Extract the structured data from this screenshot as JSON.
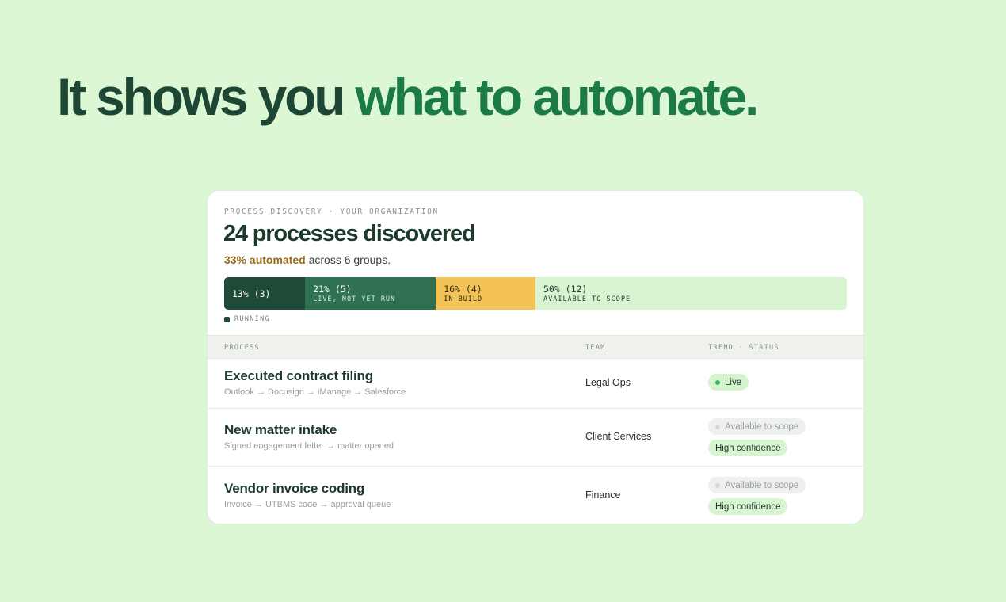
{
  "headline": {
    "prefix": "It shows you",
    "accent": "what to automate."
  },
  "card": {
    "eyebrow": "PROCESS DISCOVERY · YOUR ORGANIZATION",
    "title": "24 processes discovered",
    "automated": "33% automated",
    "subline_rest": " across 6 groups.",
    "segments": [
      {
        "value": "13% (3)",
        "label": "",
        "percent": 13,
        "color": "#1f4a37"
      },
      {
        "value": "21% (5)",
        "label": "LIVE, NOT YET RUN",
        "percent": 21,
        "color": "#2f7050"
      },
      {
        "value": "16% (4)",
        "label": "IN BUILD",
        "percent": 16,
        "color": "#f4c357"
      },
      {
        "value": "50% (12)",
        "label": "AVAILABLE TO SCOPE",
        "percent": 50,
        "color": "#d7f5d0"
      }
    ],
    "legend": "RUNNING",
    "table": {
      "headers": {
        "process": "PROCESS",
        "team": "TEAM",
        "status": "TREND · STATUS"
      },
      "rows": [
        {
          "name": "Executed contract filing",
          "path": "Outlook → Docusign → iManage → Salesforce",
          "team": "Legal Ops",
          "status": "Live",
          "confidence": ""
        },
        {
          "name": "New matter intake",
          "path": "Signed engagement letter → matter opened",
          "team": "Client Services",
          "status": "Available to scope",
          "confidence": "High confidence"
        },
        {
          "name": "Vendor invoice coding",
          "path": "Invoice → UTBMS code → approval queue",
          "team": "Finance",
          "status": "Available to scope",
          "confidence": "High confidence"
        }
      ]
    }
  }
}
